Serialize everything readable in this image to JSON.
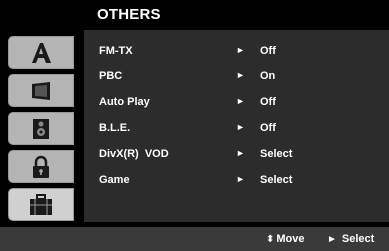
{
  "header": {
    "title": "OTHERS"
  },
  "sidebar": {
    "tabs": [
      {
        "icon": "letter-a-icon"
      },
      {
        "icon": "screen-icon"
      },
      {
        "icon": "speaker-icon"
      },
      {
        "icon": "lock-icon"
      },
      {
        "icon": "briefcase-icon"
      }
    ]
  },
  "menu": {
    "arrow": "►",
    "items": [
      {
        "label": "FM-TX",
        "value": "Off"
      },
      {
        "label": "PBC",
        "value": "On"
      },
      {
        "label": "Auto Play",
        "value": "Off"
      },
      {
        "label": "B.L.E.",
        "value": "Off"
      },
      {
        "label": "DivX(R)  VOD",
        "value": "Select"
      },
      {
        "label": "Game",
        "value": "Select"
      }
    ]
  },
  "footer": {
    "move_glyph": "⬍",
    "move_label": "Move",
    "select_glyph": "►",
    "select_label": "Select"
  }
}
